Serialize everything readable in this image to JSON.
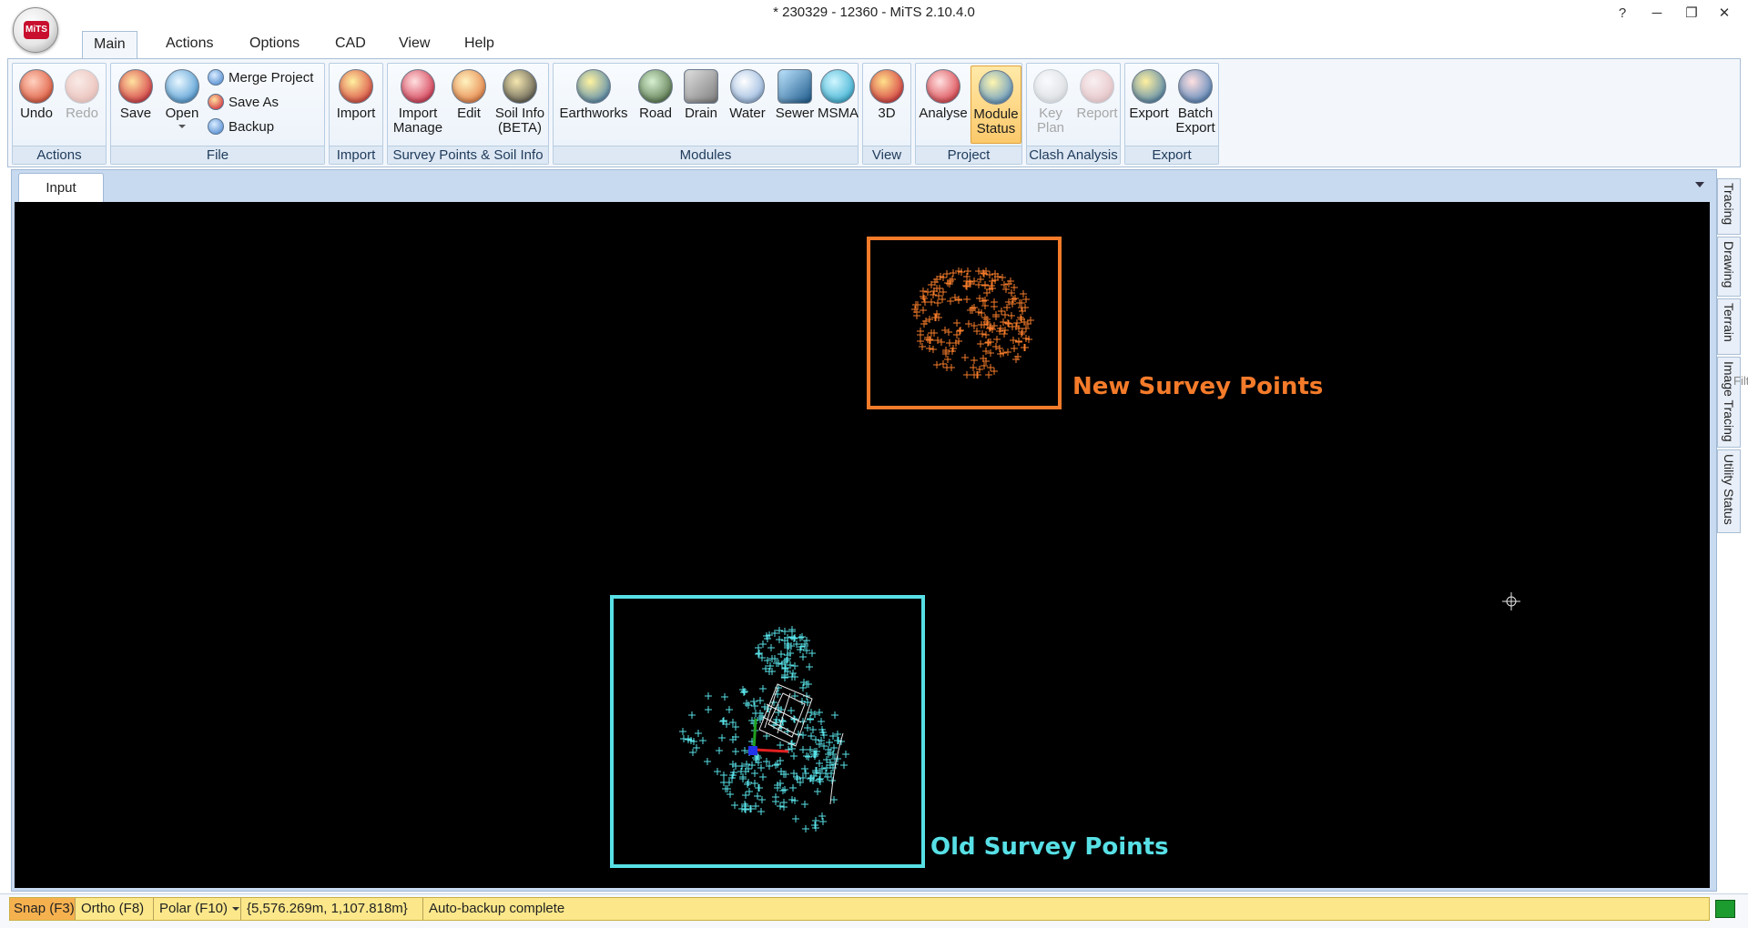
{
  "window": {
    "title": "* 230329 - 12360 - MiTS 2.10.4.0",
    "logo_text": "MiTS",
    "help_glyph": "?",
    "minimize_glyph": "─",
    "restore_glyph": "❐",
    "close_glyph": "✕"
  },
  "menu": {
    "tabs": [
      "Main",
      "Actions",
      "Options",
      "CAD",
      "View",
      "Help"
    ],
    "active": "Main"
  },
  "ribbon": {
    "groups": {
      "actions": "Actions",
      "file": "File",
      "import": "Import",
      "survey": "Survey Points & Soil Info",
      "modules": "Modules",
      "view": "View",
      "project": "Project",
      "clash": "Clash Analysis",
      "export": "Export"
    },
    "buttons": {
      "undo": "Undo",
      "redo": "Redo",
      "save": "Save",
      "open": "Open",
      "merge_project": "Merge Project",
      "save_as": "Save As",
      "backup": "Backup",
      "import": "Import",
      "import_manage_1": "Import",
      "import_manage_2": "Manage",
      "edit": "Edit",
      "soil_info_1": "Soil Info",
      "soil_info_2": "(BETA)",
      "earthworks": "Earthworks",
      "road": "Road",
      "drain": "Drain",
      "water": "Water",
      "sewer": "Sewer",
      "msma": "MSMA",
      "view_3d": "3D",
      "analyse": "Analyse",
      "module_status_1": "Module",
      "module_status_2": "Status",
      "key_plan_1": "Key",
      "key_plan_2": "Plan",
      "report": "Report",
      "export": "Export",
      "batch_export_1": "Batch",
      "batch_export_2": "Export"
    }
  },
  "document": {
    "tab": "Input"
  },
  "canvas": {
    "new_label": "New Survey Points",
    "old_label": "Old Survey Points",
    "new_color": "#f47b2a",
    "old_color": "#57e0e6",
    "background": "#000000"
  },
  "side_tabs": [
    "Tracing",
    "Drawing",
    "Terrain",
    "Image Tracing",
    "Utility Status"
  ],
  "side_cut_text": "Filt",
  "statusbar": {
    "snap": "Snap (F3)",
    "ortho": "Ortho (F8)",
    "polar": "Polar (F10)",
    "coords": "{5,576.269m, 1,107.818m}",
    "message": "Auto-backup complete",
    "indicator_color": "#1c9b2e"
  }
}
